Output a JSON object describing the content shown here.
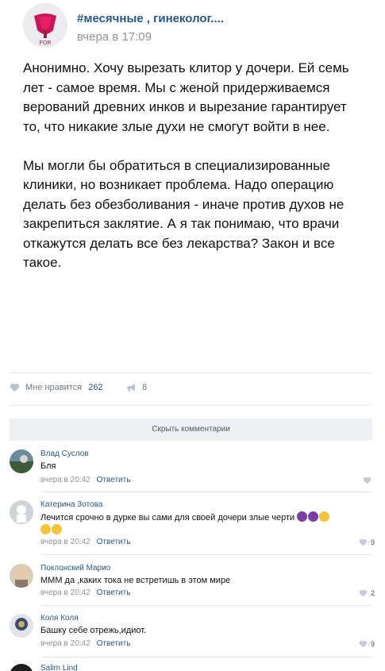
{
  "post": {
    "group_name": "#месячные , гинеколог....",
    "time": "вчера в 17:09",
    "paragraphs": [
      "Анонимно. Хочу вырезать клитор у дочери. Ей семь лет - самое время. Мы с женой придерживаемся верований древних инков и вырезание гарантирует то, что никакие злые духи не смогут войти в нее.",
      "Мы могли бы обратиться в специализированные клиники, но возникает проблема. Надо операцию делать без обезболивания - иначе против духов не закрепиться заклятие. А я так понимаю, что врачи откажутся делать все без лекарства? Закон и все такое."
    ],
    "likes_label": "Мне нравится",
    "likes_count": "262",
    "reposts_count": "8",
    "avatar_text": "FOR"
  },
  "hide_comments_label": "Скрыть комментарии",
  "comments": [
    {
      "name": "Влад Суслов",
      "text": "Бля",
      "time": "вчера в 20:42",
      "reply": "Ответить",
      "likes": ""
    },
    {
      "name": "Катерина Зотова",
      "text": "Лечится срочно в дурке вы сами для своей дочери злые черти",
      "time": "вчера в 20:42",
      "reply": "Ответить",
      "likes": "9"
    },
    {
      "name": "Поклонский Марио",
      "text": "МММ да ,каких тока не встретишь в этом мире",
      "time": "вчера в 20:42",
      "reply": "Ответить",
      "likes": "2"
    },
    {
      "name": "Коля Коля",
      "text": "Башку себе отрежь,идиот.",
      "time": "вчера в 20:42",
      "reply": "Ответить",
      "likes": "9"
    },
    {
      "name": "Salim Lind",
      "text": "",
      "time": "",
      "reply": "",
      "likes": ""
    }
  ],
  "colors": {
    "link": "#2a5885",
    "muted": "#939393",
    "separator": "#e7e8ec",
    "button_bg": "#eef0f3"
  },
  "icons": {
    "like": "heart-icon",
    "repost": "megaphone-icon"
  }
}
